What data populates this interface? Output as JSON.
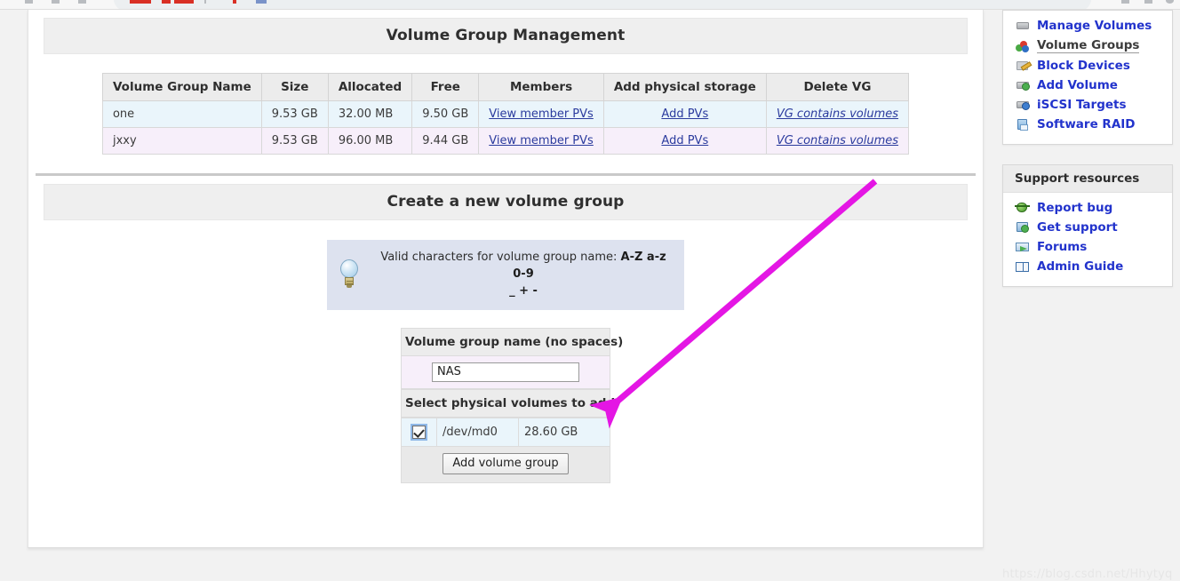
{
  "browser": {
    "present": true
  },
  "main": {
    "vg_section_title": "Volume Group Management",
    "vg_table": {
      "headers": [
        "Volume Group Name",
        "Size",
        "Allocated",
        "Free",
        "Members",
        "Add physical storage",
        "Delete VG"
      ],
      "rows": [
        {
          "name": "one",
          "size": "9.53 GB",
          "allocated": "32.00 MB",
          "free": "9.50 GB",
          "members": "View member PVs",
          "add_storage": "Add PVs",
          "delete": "VG contains volumes"
        },
        {
          "name": "jxxy",
          "size": "9.53 GB",
          "allocated": "96.00 MB",
          "free": "9.44 GB",
          "members": "View member PVs",
          "add_storage": "Add PVs",
          "delete": "VG contains volumes"
        }
      ]
    },
    "create_section_title": "Create a new volume group",
    "hint": {
      "icon": "lightbulb-icon",
      "text_plain": "Valid characters for volume group name: ",
      "text_bold_line1": "A-Z a-z 0-9",
      "text_bold_line2": "_ + -"
    },
    "form": {
      "name_label": "Volume group name (no spaces)",
      "name_value": "NAS",
      "name_placeholder": "",
      "pv_label": "Select physical volumes to add",
      "pv_rows": [
        {
          "checked": true,
          "device": "/dev/md0",
          "size": "28.60 GB"
        }
      ],
      "submit_label": "Add volume group"
    }
  },
  "sidebar": {
    "nav": {
      "items": [
        {
          "label": "Manage Volumes",
          "icon": "drive-icon",
          "active": false
        },
        {
          "label": "Volume Groups",
          "icon": "spheres-icon",
          "active": true
        },
        {
          "label": "Block Devices",
          "icon": "pencil-note-icon",
          "active": false
        },
        {
          "label": "Add Volume",
          "icon": "drive-add-icon",
          "active": false
        },
        {
          "label": "iSCSI Targets",
          "icon": "drive-network-icon",
          "active": false
        },
        {
          "label": "Software RAID",
          "icon": "blue-disk-icon",
          "active": false
        }
      ]
    },
    "support": {
      "title": "Support resources",
      "items": [
        {
          "label": "Report bug",
          "icon": "bug-icon"
        },
        {
          "label": "Get support",
          "icon": "box-plus-icon"
        },
        {
          "label": "Forums",
          "icon": "mail-icon"
        },
        {
          "label": "Admin Guide",
          "icon": "book-icon"
        }
      ]
    }
  },
  "annotation": {
    "arrow_color": "#e416e4",
    "arrow_from": "985,204",
    "arrow_to": "676,466"
  },
  "watermark": {
    "text": "https://blog.csdn.net/Hhytyq"
  },
  "colors": {
    "link": "#2233cc",
    "header_bg": "#ececec",
    "row_a": "#eaf5fb",
    "row_b": "#f7effa",
    "hint_bg": "#dde2ef",
    "arrow": "#e416e4"
  }
}
